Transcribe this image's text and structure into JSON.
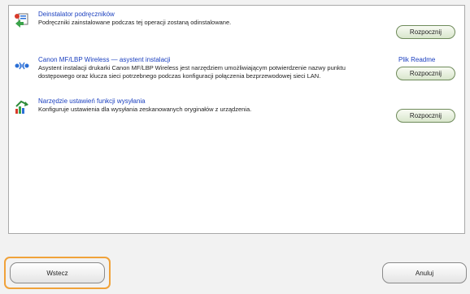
{
  "tools": [
    {
      "title": "Deinstalator podręczników",
      "description": "Podręczniki zainstalowane podczas tej operacji zostaną odinstalowane.",
      "button_label": "Rozpocznij",
      "icon": "uninstall-icon"
    },
    {
      "title": "Canon MF/LBP Wireless — asystent instalacji",
      "description": "Asystent instalacji drukarki Canon MF/LBP Wireless jest narzędziem umożliwiającym potwierdzenie nazwy punktu dostępowego oraz klucza sieci potrzebnego podczas konfiguracji połączenia bezprzewodowej sieci LAN.",
      "link_label": "Plik Readme",
      "button_label": "Rozpocznij",
      "icon": "wireless-icon"
    },
    {
      "title": "Narzędzie ustawień funkcji wysyłania",
      "description": "Konfiguruje ustawienia dla wysyłania zeskanowanych oryginałów z urządzenia.",
      "button_label": "Rozpocznij",
      "icon": "send-settings-icon"
    }
  ],
  "footer": {
    "back_label": "Wstecz",
    "cancel_label": "Anuluj"
  },
  "colors": {
    "link": "#1a3fbf",
    "highlight": "#f0a23a",
    "green_button": "#d9e6cc"
  }
}
